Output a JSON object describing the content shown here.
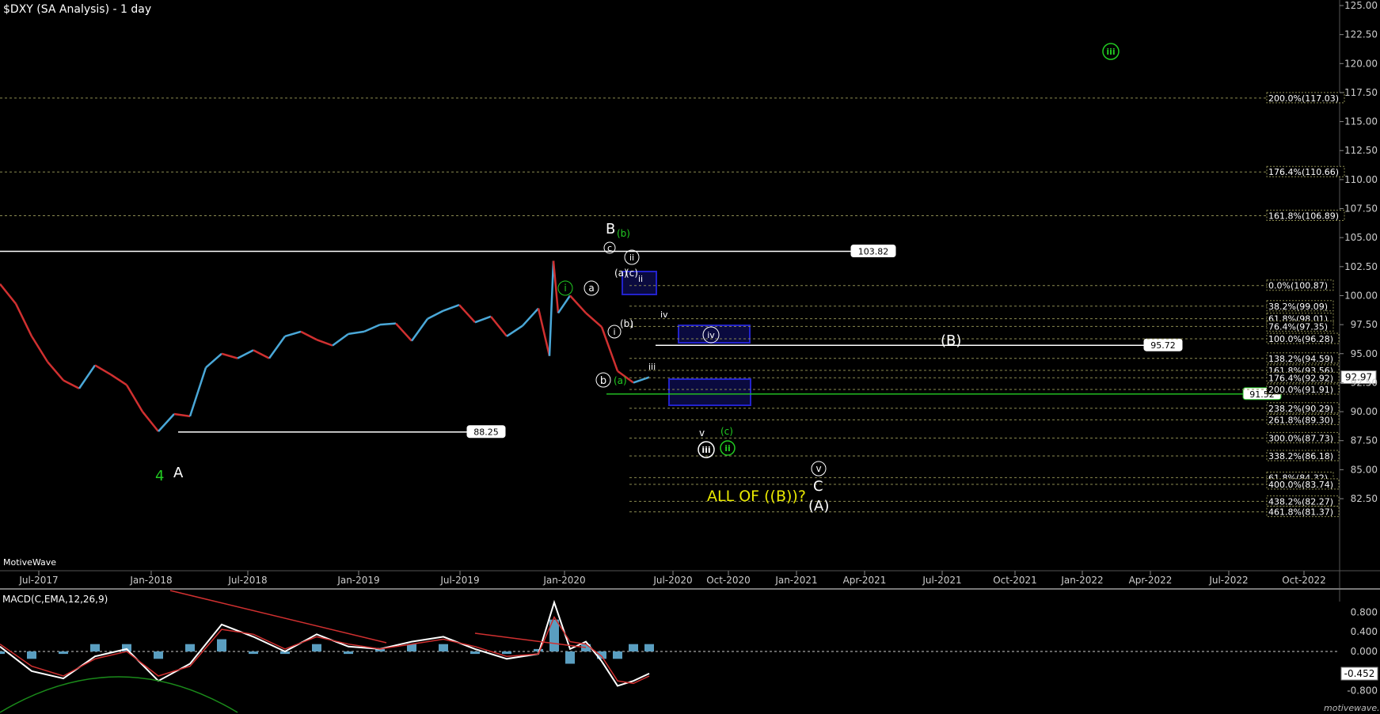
{
  "window": {
    "title": "$DXY (SA Analysis) - 1 day",
    "watermark": "MotiveWave",
    "footer": "motivewave.com"
  },
  "chart_data": [
    {
      "type": "line",
      "name": "price",
      "ylim": [
        80,
        125
      ],
      "y_ticks": [
        "82.50",
        "85.00",
        "87.50",
        "90.00",
        "92.50",
        "95.00",
        "97.50",
        "100.00",
        "102.50",
        "105.00",
        "107.50",
        "110.00",
        "112.50",
        "115.00",
        "117.50",
        "120.00",
        "122.50",
        "125.00"
      ],
      "x_ticks": [
        "Jul-2017",
        "Jan-2018",
        "Jul-2018",
        "Jan-2019",
        "Jul-2019",
        "Jan-2020",
        "Jul-2020",
        "Oct-2020",
        "Jan-2021",
        "Apr-2021",
        "Jul-2021",
        "Oct-2021",
        "Jan-2022",
        "Apr-2022",
        "Jul-2022",
        "Oct-2022"
      ],
      "x": [
        "2017-04",
        "2017-05",
        "2017-06",
        "2017-07",
        "2017-08",
        "2017-09",
        "2017-10",
        "2017-11",
        "2017-12",
        "2018-01",
        "2018-02",
        "2018-03",
        "2018-04",
        "2018-05",
        "2018-06",
        "2018-07",
        "2018-08",
        "2018-09",
        "2018-10",
        "2018-11",
        "2018-12",
        "2019-01",
        "2019-02",
        "2019-03",
        "2019-04",
        "2019-05",
        "2019-06",
        "2019-07",
        "2019-08",
        "2019-09",
        "2019-10",
        "2019-11",
        "2019-12",
        "2020-01",
        "2020-02",
        "2020-03a",
        "2020-03b",
        "2020-03c",
        "2020-04",
        "2020-05",
        "2020-06",
        "2020-07",
        "2020-08",
        "2020-09"
      ],
      "y": [
        101.0,
        99.3,
        96.5,
        94.3,
        92.7,
        92.0,
        94.0,
        93.2,
        92.3,
        90.0,
        88.3,
        89.8,
        89.6,
        93.8,
        95.0,
        94.6,
        95.3,
        94.6,
        96.5,
        96.9,
        96.2,
        95.7,
        96.7,
        96.9,
        97.5,
        97.6,
        96.1,
        98.0,
        98.7,
        99.2,
        97.7,
        98.2,
        96.5,
        97.4,
        98.9,
        94.8,
        103.0,
        98.5,
        100.0,
        98.5,
        97.3,
        93.5,
        92.5,
        92.97
      ],
      "last_price": "92.97",
      "horizontal_levels": [
        {
          "label": "103.82",
          "y": 103.82,
          "color": "#ffffff"
        },
        {
          "label": "95.72",
          "y": 95.72,
          "color": "#ffffff"
        },
        {
          "label": "91.52",
          "y": 91.52,
          "color": "#22bb22"
        },
        {
          "label": "88.25",
          "y": 88.25,
          "color": "#ffffff"
        }
      ],
      "fib_labels": [
        {
          "label": "200.0%(117.03)",
          "y": 117.03
        },
        {
          "label": "176.4%(110.66)",
          "y": 110.66
        },
        {
          "label": "161.8%(106.89)",
          "y": 106.89
        },
        {
          "label": "0.0%(100.87)",
          "y": 100.87
        },
        {
          "label": "38.2%(99.09)",
          "y": 99.09
        },
        {
          "label": "61.8%(98.01)",
          "y": 98.01
        },
        {
          "label": "76.4%(97.35)",
          "y": 97.35
        },
        {
          "label": "100.0%(96.28)",
          "y": 96.28
        },
        {
          "label": "138.2%(94.59)",
          "y": 94.59
        },
        {
          "label": "161.8%(93.56)",
          "y": 93.56
        },
        {
          "label": "176.4%(92.92)",
          "y": 92.92
        },
        {
          "label": "200.0%(91.91)",
          "y": 91.91
        },
        {
          "label": "238.2%(90.29)",
          "y": 90.29
        },
        {
          "label": "261.8%(89.30)",
          "y": 89.3
        },
        {
          "label": "300.0%(87.73)",
          "y": 87.73
        },
        {
          "label": "338.2%(86.18)",
          "y": 86.18
        },
        {
          "label": "61.8%(84.32)",
          "y": 84.32
        },
        {
          "label": "400.0%(83.74)",
          "y": 83.74
        },
        {
          "label": "438.2%(82.27)",
          "y": 82.27
        },
        {
          "label": "461.8%(81.37)",
          "y": 81.37
        }
      ],
      "wave_labels": [
        {
          "text": "B",
          "color": "#ffffff",
          "circled": false
        },
        {
          "text": "(b)",
          "color": "#22cc22",
          "circled": false
        },
        {
          "text": "c",
          "color": "#ffffff",
          "circled": true
        },
        {
          "text": "ii",
          "color": "#ffffff",
          "circled": true
        },
        {
          "text": "(a)",
          "color": "#ffffff",
          "circled": false
        },
        {
          "text": "(c)",
          "color": "#ffffff",
          "circled": false
        },
        {
          "text": "ii",
          "color": "#ffffff",
          "circled": false
        },
        {
          "text": "a",
          "color": "#ffffff",
          "circled": true
        },
        {
          "text": "i",
          "color": "#22cc22",
          "circled": true
        },
        {
          "text": "i",
          "color": "#ffffff",
          "circled": true
        },
        {
          "text": "(b)",
          "color": "#ffffff",
          "circled": false
        },
        {
          "text": "i",
          "color": "#ffffff",
          "circled": false
        },
        {
          "text": "iv",
          "color": "#ffffff",
          "circled": false
        },
        {
          "text": "iv",
          "color": "#ffffff",
          "circled": true
        },
        {
          "text": "iii",
          "color": "#ffffff",
          "circled": false
        },
        {
          "text": "b",
          "color": "#ffffff",
          "circled": true
        },
        {
          "text": "(a)",
          "color": "#22cc22",
          "circled": false
        },
        {
          "text": "(B)",
          "color": "#ffffff",
          "circled": false
        },
        {
          "text": "iii",
          "color": "#22cc22",
          "circled": true
        },
        {
          "text": "v",
          "color": "#ffffff",
          "circled": false
        },
        {
          "text": "(c)",
          "color": "#22cc22",
          "circled": false
        },
        {
          "text": "iii",
          "color": "#ffffff",
          "circled": true
        },
        {
          "text": "ii",
          "color": "#22cc22",
          "circled": true
        },
        {
          "text": "v",
          "color": "#ffffff",
          "circled": true
        },
        {
          "text": "C",
          "color": "#ffffff",
          "circled": false
        },
        {
          "text": "(A)",
          "color": "#ffffff",
          "circled": false
        },
        {
          "text": "4",
          "color": "#22cc22",
          "circled": false
        },
        {
          "text": "A",
          "color": "#ffffff",
          "circled": false
        }
      ],
      "annotation": {
        "text": "ALL OF ((B))?",
        "color": "#e8e800"
      },
      "colors": {
        "up": "#4aa8d8",
        "down": "#d03030",
        "accent": "#22cc22",
        "box": "#2222cc"
      }
    },
    {
      "type": "line",
      "name": "macd",
      "title": "MACD(C,EMA,12,26,9)",
      "ylim": [
        -0.9,
        1.0
      ],
      "y_ticks": [
        "0.800",
        "0.400",
        "0.000",
        "-0.400",
        "-0.800"
      ],
      "last_value": "-0.452",
      "x": [
        "2017-04",
        "2017-06",
        "2017-08",
        "2017-10",
        "2017-12",
        "2018-02",
        "2018-04",
        "2018-06",
        "2018-08",
        "2018-10",
        "2018-12",
        "2019-02",
        "2019-04",
        "2019-06",
        "2019-08",
        "2019-10",
        "2019-12",
        "2020-02",
        "2020-03",
        "2020-04",
        "2020-05",
        "2020-06",
        "2020-07",
        "2020-08",
        "2020-09"
      ],
      "series": [
        {
          "values": [
            0.1,
            -0.4,
            -0.55,
            -0.1,
            0.05,
            -0.6,
            -0.25,
            0.55,
            0.3,
            0.0,
            0.35,
            0.1,
            0.05,
            0.2,
            0.3,
            0.05,
            -0.15,
            -0.05,
            1.0,
            0.05,
            0.2,
            -0.2,
            -0.7,
            -0.6,
            -0.45
          ],
          "color": "#ffffff"
        },
        {
          "values": [
            0.15,
            -0.3,
            -0.5,
            -0.15,
            0.0,
            -0.5,
            -0.3,
            0.45,
            0.35,
            0.05,
            0.3,
            0.15,
            0.05,
            0.15,
            0.25,
            0.1,
            -0.1,
            -0.05,
            0.7,
            0.2,
            0.15,
            -0.1,
            -0.6,
            -0.65,
            -0.5
          ],
          "color": "#d03030"
        }
      ],
      "colors": {
        "histogram": "#5a9ec0"
      }
    }
  ]
}
